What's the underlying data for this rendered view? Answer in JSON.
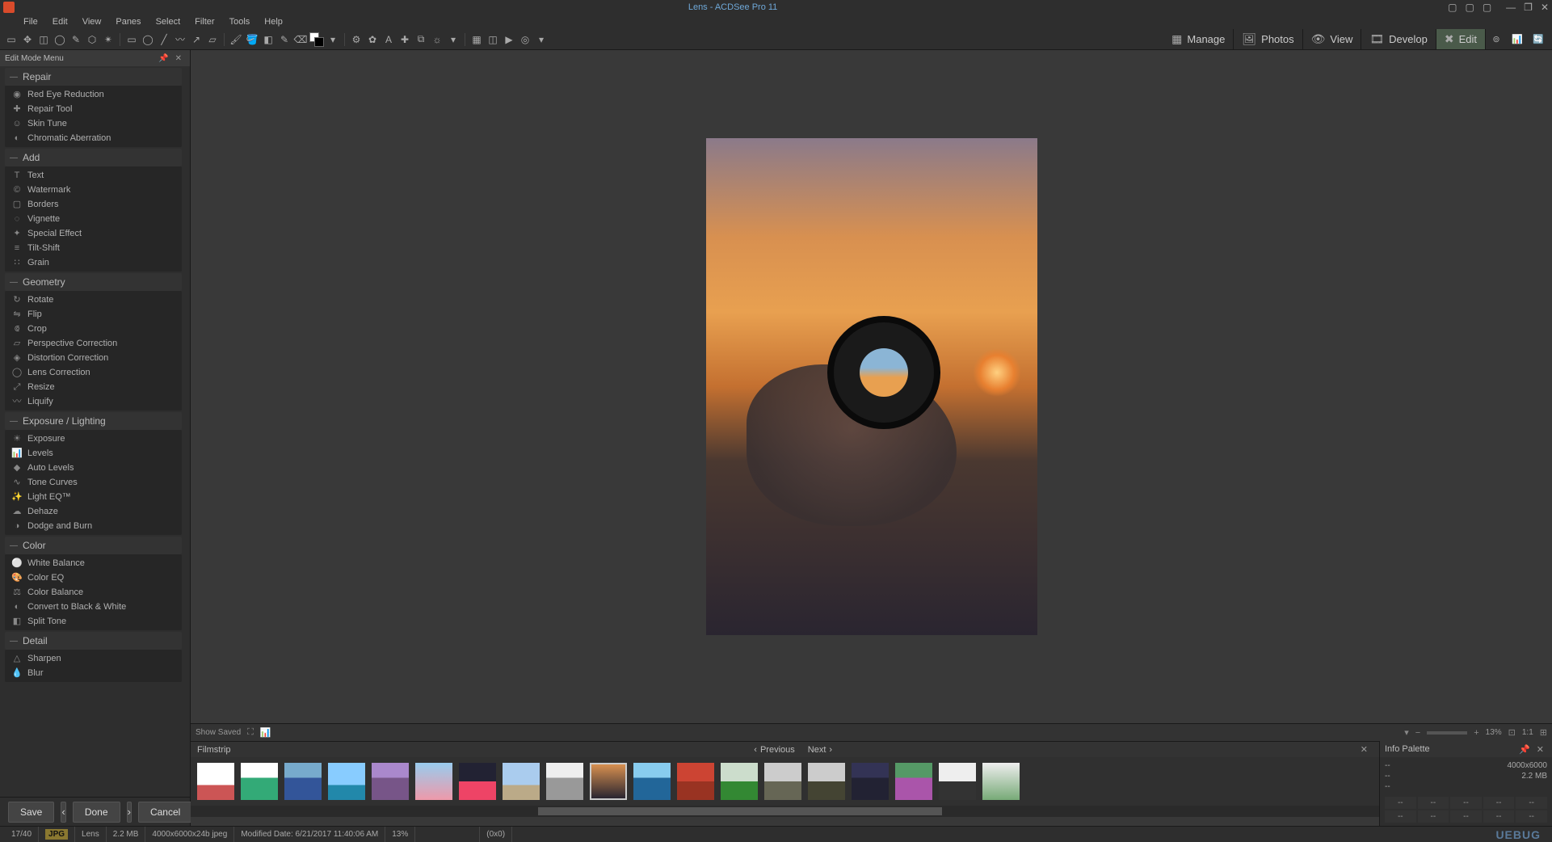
{
  "app": {
    "title": "Lens - ACDSee Pro 11"
  },
  "menubar": [
    "File",
    "Edit",
    "View",
    "Panes",
    "Select",
    "Filter",
    "Tools",
    "Help"
  ],
  "modetabs": {
    "manage": "Manage",
    "photos": "Photos",
    "view": "View",
    "develop": "Develop",
    "edit": "Edit"
  },
  "leftpanel": {
    "title": "Edit Mode Menu",
    "sections": [
      {
        "title": "Repair",
        "items": [
          "Red Eye Reduction",
          "Repair Tool",
          "Skin Tune",
          "Chromatic Aberration"
        ]
      },
      {
        "title": "Add",
        "items": [
          "Text",
          "Watermark",
          "Borders",
          "Vignette",
          "Special Effect",
          "Tilt-Shift",
          "Grain"
        ]
      },
      {
        "title": "Geometry",
        "items": [
          "Rotate",
          "Flip",
          "Crop",
          "Perspective Correction",
          "Distortion Correction",
          "Lens Correction",
          "Resize",
          "Liquify"
        ]
      },
      {
        "title": "Exposure / Lighting",
        "items": [
          "Exposure",
          "Levels",
          "Auto Levels",
          "Tone Curves",
          "Light EQ™",
          "Dehaze",
          "Dodge and Burn"
        ]
      },
      {
        "title": "Color",
        "items": [
          "White Balance",
          "Color EQ",
          "Color Balance",
          "Convert to Black & White",
          "Split Tone"
        ]
      },
      {
        "title": "Detail",
        "items": [
          "Sharpen",
          "Blur"
        ]
      }
    ]
  },
  "canvastools": {
    "showsaved": "Show Saved",
    "zoom": "13%",
    "oneToOne": "1:1"
  },
  "filmstrip": {
    "title": "Filmstrip",
    "prev": "Previous",
    "next": "Next"
  },
  "infopanel": {
    "title": "Info Palette",
    "dims": "4000x6000",
    "size": "2.2 MB",
    "na": "--"
  },
  "actions": {
    "save": "Save",
    "done": "Done",
    "cancel": "Cancel"
  },
  "status": {
    "index": "17/40",
    "format": "JPG",
    "name": "Lens",
    "size": "2.2 MB",
    "dims": "4000x6000x24b jpeg",
    "modified": "Modified Date: 6/21/2017 11:40:06 AM",
    "zoom": "13%",
    "coords": "(0x0)",
    "watermark": "UEBUG"
  }
}
